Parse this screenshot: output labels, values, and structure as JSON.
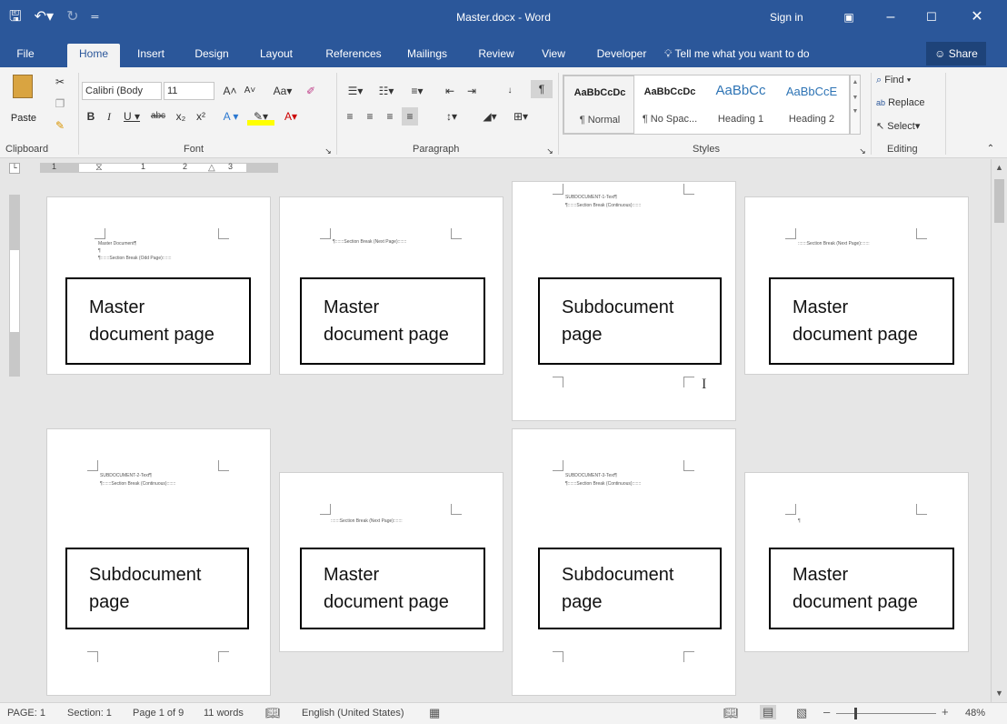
{
  "titlebar": {
    "title": "Master.docx - Word",
    "sign_in": "Sign in",
    "qat_icons": [
      "save-icon",
      "undo-icon",
      "redo-icon",
      "customize-icon"
    ]
  },
  "tabs": [
    "File",
    "Home",
    "Insert",
    "Design",
    "Layout",
    "References",
    "Mailings",
    "Review",
    "View",
    "Developer"
  ],
  "active_tab": "Home",
  "tell_me": "Tell me what you want to do",
  "share": "Share",
  "ribbon": {
    "clipboard": {
      "paste": "Paste",
      "label": "Clipboard"
    },
    "font": {
      "name": "Calibri (Body",
      "size": "11",
      "label": "Font",
      "case": "Aa"
    },
    "paragraph": {
      "label": "Paragraph"
    },
    "styles": {
      "label": "Styles",
      "items": [
        {
          "preview": "AaBbCcDc",
          "name": "¶ Normal"
        },
        {
          "preview": "AaBbCcDc",
          "name": "¶ No Spac..."
        },
        {
          "preview": "AaBbCc",
          "name": "Heading 1"
        },
        {
          "preview": "AaBbCcE",
          "name": "Heading 2"
        }
      ]
    },
    "editing": {
      "label": "Editing",
      "find": "Find",
      "replace": "Replace",
      "select": "Select"
    }
  },
  "ruler": {
    "numbers": [
      "1",
      "1",
      "2",
      "3"
    ]
  },
  "pages": [
    {
      "label": "Master\ndocument page",
      "lines": [
        "Master Document¶",
        "¶",
        "¶:::::::Section Break (Odd Page):::::::"
      ]
    },
    {
      "label": "Master\ndocument page",
      "lines": [
        "¶:::::::Section Break (Next Page):::::::"
      ]
    },
    {
      "label": "Subdocument\npage",
      "lines": [
        "SUBDOCUMENT-1-Text¶",
        "¶:::::::Section Break (Continuous):::::::"
      ]
    },
    {
      "label": "Master\ndocument page",
      "lines": [
        ":::::::Section Break (Next Page):::::::"
      ]
    },
    {
      "label": "Subdocument\npage",
      "lines": [
        "SUBDOCUMENT-2-Text¶",
        "¶:::::::Section Break (Continuous):::::::"
      ]
    },
    {
      "label": "Master\ndocument page",
      "lines": [
        ":::::::Section Break (Next Page):::::::"
      ]
    },
    {
      "label": "Subdocument\npage",
      "lines": [
        "SUBDOCUMENT-3-Text¶",
        "¶:::::::Section Break (Continuous):::::::"
      ]
    },
    {
      "label": "Master\ndocument page",
      "lines": [
        "¶"
      ]
    }
  ],
  "status": {
    "page": "PAGE: 1",
    "section": "Section: 1",
    "page_of": "Page 1 of 9",
    "words": "11 words",
    "language": "English (United States)",
    "zoom": "48%",
    "zoom_fraction": 0.48
  }
}
